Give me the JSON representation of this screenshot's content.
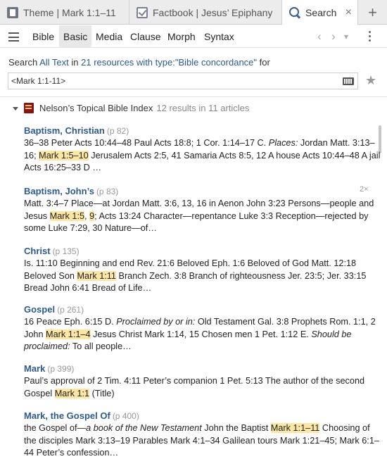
{
  "tabs": [
    {
      "label": "Theme | Mark 1:1–11",
      "icon": "document-icon"
    },
    {
      "label": "Factbook | Jesus’ Epiphany",
      "icon": "checkbox-icon"
    },
    {
      "label": "Search",
      "icon": "magnifier-icon",
      "close": "×"
    }
  ],
  "add_tab": "+",
  "toolbar": {
    "tabs": [
      "Bible",
      "Basic",
      "Media",
      "Clause",
      "Morph",
      "Syntax"
    ],
    "active": "Basic",
    "back": "‹",
    "forward": "›",
    "dropdown": "▾"
  },
  "search": {
    "prefix": "Search",
    "scope": "All Text",
    "in": "in",
    "resources": "21 resources with type:\"Bible concordance\"",
    "suffix": "for",
    "query": "<Mark 1:1-11>"
  },
  "resource": {
    "title": "Nelson’s Topical Bible Index",
    "count": "12 results in 11 articles"
  },
  "results": [
    {
      "title": "Baptism, Christian",
      "page": "(p 82)",
      "lines": [
        [
          {
            "t": "36–38 Peter Acts 10:44–48 Paul Acts 18:8; 1 Cor. 1:14–17 C.    "
          },
          {
            "t": "Places:",
            "i": true
          },
          {
            "t": " Jordan Matt. 3:13–"
          }
        ],
        [
          {
            "t": "16; "
          },
          {
            "t": "Mark 1:5–10",
            "h": true
          },
          {
            "t": " Jerusalem Acts 2:5, 41 Samaria Acts 8:5, 12 A house Acts 10:44–48 A jail"
          }
        ],
        [
          {
            "t": "Acts 16:25–33 D    …"
          }
        ]
      ]
    },
    {
      "title": "Baptism, John’s",
      "page": "(p 83)",
      "badge": "2×",
      "lines": [
        [
          {
            "t": "Matt. 3:4–7 Place—at Jordan Matt. 3:6, 13, 16 in Aenon John 3:23 Persons—people and"
          }
        ],
        [
          {
            "t": "Jesus "
          },
          {
            "t": "Mark 1:5",
            "h": true
          },
          {
            "t": ", "
          },
          {
            "t": "9",
            "h": true
          },
          {
            "t": "; Acts 13:24 Character—repentance Luke 3:3 Reception—rejected by"
          }
        ],
        [
          {
            "t": "some Luke 7:29, 30 Nature—of…"
          }
        ]
      ]
    },
    {
      "title": "Christ",
      "page": "(p 135)",
      "lines": [
        [
          {
            "t": "Is. 11:10 Beginning and end Rev. 21:6 Beloved Eph. 1:6 Beloved of God Matt. 12:18"
          }
        ],
        [
          {
            "t": "Beloved Son "
          },
          {
            "t": "Mark 1:11",
            "h": true
          },
          {
            "t": " Branch Zech. 3:8 Branch of righteousness Jer. 23:5; Jer. 33:15"
          }
        ],
        [
          {
            "t": "Bread John 6:41 Bread of Life…"
          }
        ]
      ]
    },
    {
      "title": "Gospel",
      "page": "(p 261)",
      "lines": [
        [
          {
            "t": "16 Peace Eph. 6:15 D.    "
          },
          {
            "t": "Proclaimed by or in:",
            "i": true
          },
          {
            "t": " Old Testament Gal. 3:8 Prophets Rom. 1:1, 2"
          }
        ],
        [
          {
            "t": "John "
          },
          {
            "t": "Mark 1:1–4",
            "h": true
          },
          {
            "t": " Jesus Christ Mark 1:14, 15 Chosen men 1 Pet. 1:12 E.    "
          },
          {
            "t": "Should be",
            "i": true
          }
        ],
        [
          {
            "t": "proclaimed:",
            "i": true
          },
          {
            "t": " To all people…"
          }
        ]
      ]
    },
    {
      "title": "Mark",
      "page": "(p 399)",
      "lines": [
        [
          {
            "t": "Paul’s approval of 2 Tim. 4:11 Peter’s companion 1 Pet. 5:13 The author of the second"
          }
        ],
        [
          {
            "t": "Gospel "
          },
          {
            "t": "Mark 1:1",
            "h": true
          },
          {
            "t": " (Title)"
          }
        ]
      ]
    },
    {
      "title": "Mark, the Gospel Of",
      "page": "(p 400)",
      "lines": [
        [
          {
            "t": "the Gospel of—"
          },
          {
            "t": "a book of the New Testament",
            "i": true
          },
          {
            "t": " John the Baptist "
          },
          {
            "t": "Mark 1:1–11",
            "h": true
          },
          {
            "t": " Choosing of"
          }
        ],
        [
          {
            "t": "the disciples Mark 3:13–19 Parables Mark 4:1–34 Galilean tours Mark 1:21–45; Mark 6:1–"
          }
        ],
        [
          {
            "t": "44 Peter’s confession…"
          }
        ]
      ]
    }
  ]
}
